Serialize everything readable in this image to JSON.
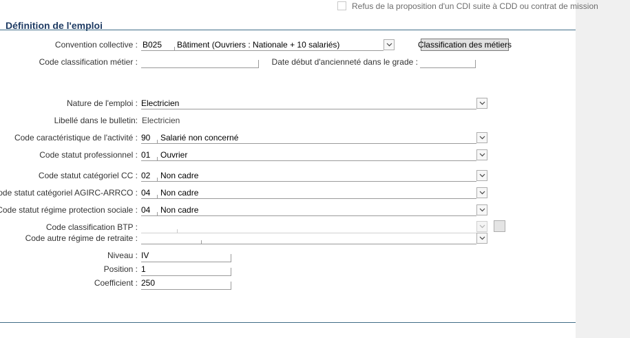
{
  "header": {
    "cdi_refusal_label": "Refus de la proposition d'un CDI suite à CDD ou contrat de mission",
    "cdi_refusal_checked": false
  },
  "section": {
    "title": "Définition de l'emploi"
  },
  "convention": {
    "label": "Convention collective :",
    "code": "B025",
    "value": "Bâtiment (Ouvriers : Nationale + 10 salariés)",
    "button_label": "Classification des métiers"
  },
  "code_classification_metier": {
    "label": "Code classification métier :",
    "value": ""
  },
  "date_debut_anciennete": {
    "label": "Date début d'ancienneté dans le grade :",
    "value": ""
  },
  "nature_emploi": {
    "label": "Nature de l'emploi :",
    "value": "Electricien"
  },
  "libelle_bulletin": {
    "label": "Libellé dans le bulletin:",
    "value": "Electricien"
  },
  "code_caracteristique": {
    "label": "Code caractéristique de l'activité :",
    "code": "90",
    "value": "Salarié non concerné"
  },
  "code_statut_pro": {
    "label": "Code statut professionnel :",
    "code": "01",
    "value": "Ouvrier"
  },
  "code_statut_cat_cc": {
    "label": "Code statut catégoriel CC :",
    "code": "02",
    "value": "Non cadre"
  },
  "code_statut_agirc": {
    "label": "Code statut catégoriel AGIRC-ARRCO :",
    "code": "04",
    "value": "Non cadre"
  },
  "code_statut_regime": {
    "label": "Code statut régime protection sociale :",
    "code": "04",
    "value": "Non cadre"
  },
  "code_classification_btp": {
    "label": "Code classification BTP :",
    "code": "",
    "value": ""
  },
  "code_autre_regime": {
    "label": "Code autre régime de retraite :",
    "code": "",
    "value": ""
  },
  "niveau": {
    "label": "Niveau :",
    "value": "IV"
  },
  "position": {
    "label": "Position :",
    "value": "1"
  },
  "coefficient": {
    "label": "Coefficient :",
    "value": "250"
  }
}
